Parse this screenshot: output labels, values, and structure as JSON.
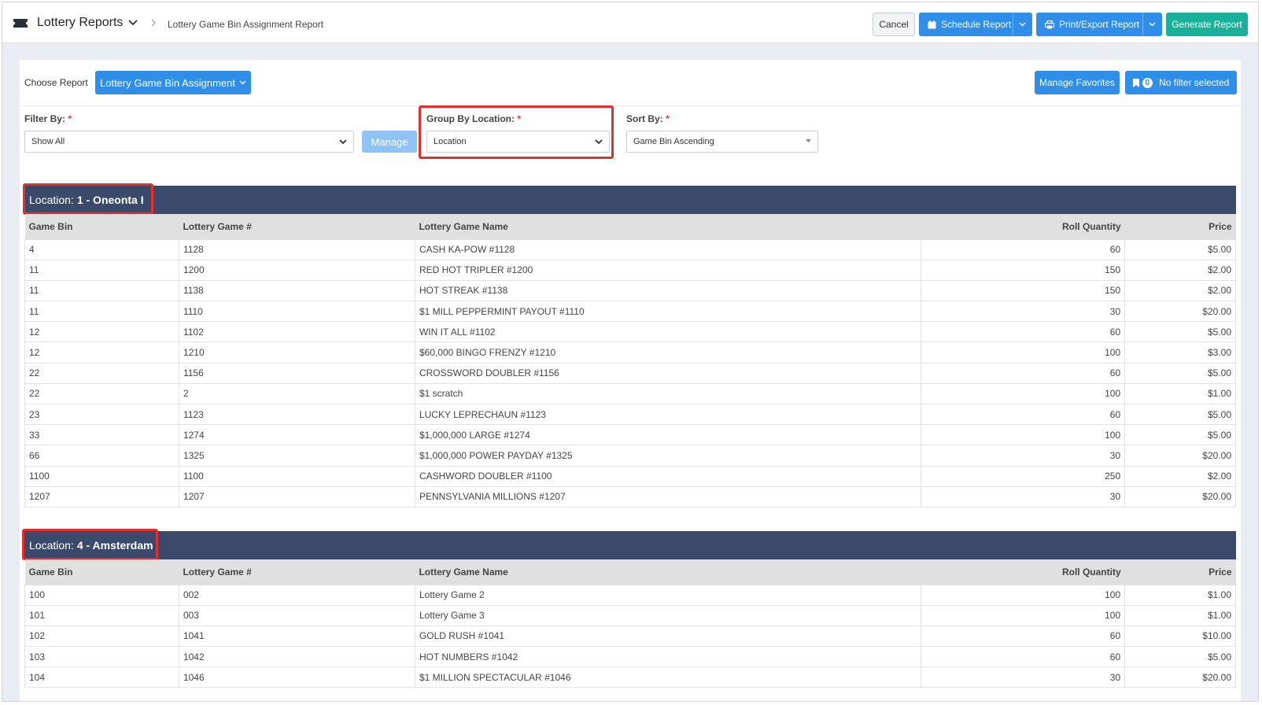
{
  "header": {
    "app_title": "Lottery Reports",
    "breadcrumb_current": "Lottery Game Bin Assignment Report",
    "cancel_label": "Cancel",
    "schedule_label": "Schedule Report",
    "print_label": "Print/Export Report",
    "generate_label": "Generate Report"
  },
  "report": {
    "choose_label": "Choose Report",
    "selected_report": "Lottery Game Bin Assignment",
    "manage_favorites_label": "Manage Favorites",
    "filter_count": "0",
    "filter_status": "No filter selected"
  },
  "filters": {
    "filter_by_label": "Filter By:",
    "filter_by_value": "Show All",
    "manage_label": "Manage",
    "group_by_label": "Group By Location:",
    "group_by_value": "Location",
    "sort_by_label": "Sort By:",
    "sort_by_value": "Game Bin Ascending",
    "required_mark": "*"
  },
  "columns": [
    "Game Bin",
    "Lottery Game #",
    "Lottery Game Name",
    "Roll Quantity",
    "Price"
  ],
  "locations": [
    {
      "prefix": "Location:",
      "name": "1 - Oneonta I",
      "rows": [
        [
          "4",
          "1128",
          "CASH KA-POW #1128",
          "60",
          "$5.00"
        ],
        [
          "11",
          "1200",
          "RED HOT TRIPLER #1200",
          "150",
          "$2.00"
        ],
        [
          "11",
          "1138",
          "HOT STREAK #1138",
          "150",
          "$2.00"
        ],
        [
          "11",
          "1110",
          "$1 MILL PEPPERMINT PAYOUT #1110",
          "30",
          "$20.00"
        ],
        [
          "12",
          "1102",
          "WIN IT ALL #1102",
          "60",
          "$5.00"
        ],
        [
          "12",
          "1210",
          "$60,000 BINGO FRENZY #1210",
          "100",
          "$3.00"
        ],
        [
          "22",
          "1156",
          "CROSSWORD DOUBLER #1156",
          "60",
          "$5.00"
        ],
        [
          "22",
          "2",
          "$1 scratch",
          "100",
          "$1.00"
        ],
        [
          "23",
          "1123",
          "LUCKY LEPRECHAUN #1123",
          "60",
          "$5.00"
        ],
        [
          "33",
          "1274",
          "$1,000,000 LARGE #1274",
          "100",
          "$5.00"
        ],
        [
          "66",
          "1325",
          "$1,000,000 POWER PAYDAY #1325",
          "30",
          "$20.00"
        ],
        [
          "1100",
          "1100",
          "CASHWORD DOUBLER #1100",
          "250",
          "$2.00"
        ],
        [
          "1207",
          "1207",
          "PENNSYLVANIA MILLIONS #1207",
          "30",
          "$20.00"
        ]
      ]
    },
    {
      "prefix": "Location:",
      "name": "4 - Amsterdam",
      "rows": [
        [
          "100",
          "002",
          "Lottery Game 2",
          "100",
          "$1.00"
        ],
        [
          "101",
          "003",
          "Lottery Game 3",
          "100",
          "$1.00"
        ],
        [
          "102",
          "1041",
          "GOLD RUSH #1041",
          "60",
          "$10.00"
        ],
        [
          "103",
          "1042",
          "HOT NUMBERS #1042",
          "60",
          "$5.00"
        ],
        [
          "104",
          "1046",
          "$1 MILLION SPECTACULAR #1046",
          "30",
          "$20.00"
        ]
      ]
    }
  ],
  "colors": {
    "primary": "#2f8ee8",
    "success": "#1ab19a",
    "location_header": "#3b4a6b",
    "highlight": "#e0312f"
  }
}
